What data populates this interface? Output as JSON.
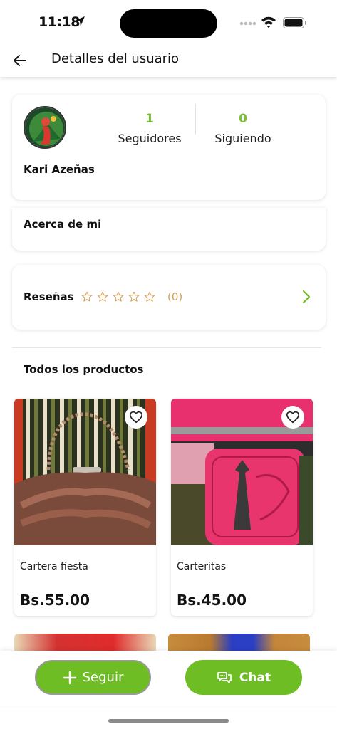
{
  "status_bar": {
    "time": "11:18"
  },
  "header": {
    "title": "Detalles del usuario"
  },
  "profile": {
    "name": "Kari Azeñas",
    "followers_count": "1",
    "followers_label": "Seguidores",
    "following_count": "0",
    "following_label": "Siguiendo"
  },
  "about": {
    "title": "Acerca de mi"
  },
  "reviews": {
    "title": "Reseñas",
    "count": "(0)",
    "rating": 0,
    "max_rating": 5
  },
  "products_section": {
    "title": "Todos los productos"
  },
  "products": [
    {
      "name": "Cartera fiesta",
      "price": "Bs.55.00"
    },
    {
      "name": "Carteritas",
      "price": "Bs.45.00"
    }
  ],
  "actions": {
    "follow_label": "Seguir",
    "chat_label": "Chat"
  },
  "colors": {
    "accent": "#6fbd24",
    "count_green": "#7cbf3b",
    "star_outline": "#d6a25c"
  }
}
